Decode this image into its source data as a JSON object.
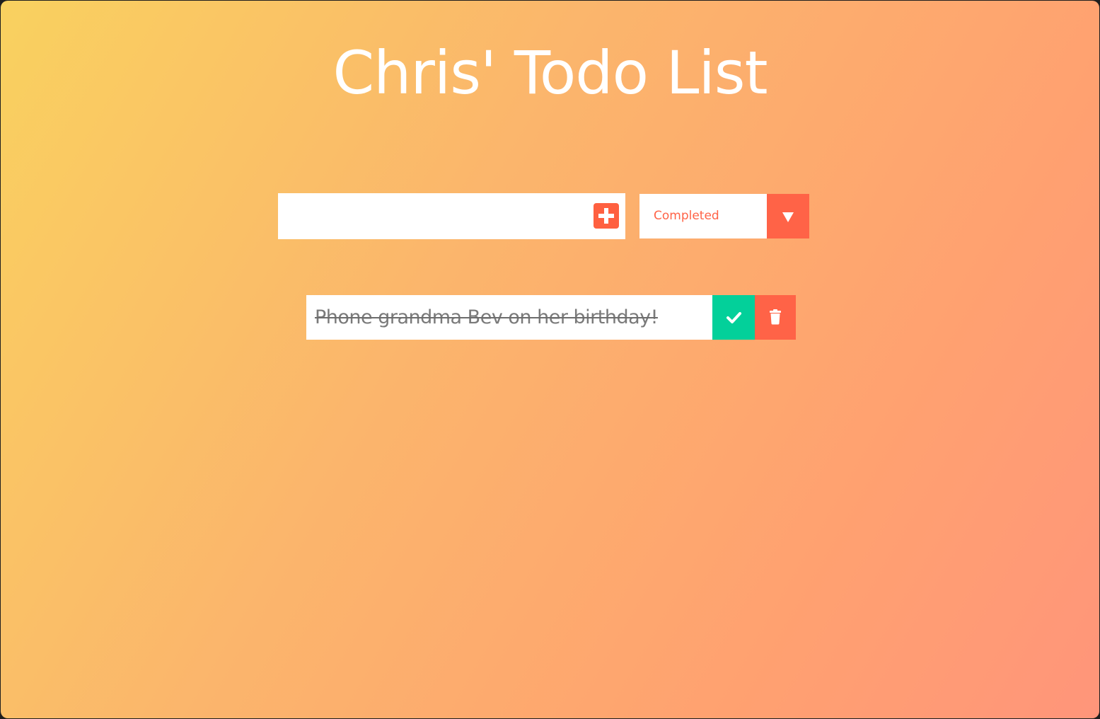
{
  "header": {
    "title": "Chris' Todo List"
  },
  "form": {
    "input_value": "",
    "input_placeholder": "",
    "add_icon": "plus-square-icon"
  },
  "filter": {
    "selected": "Completed",
    "arrow_icon": "caret-down-icon"
  },
  "todos": [
    {
      "text": "Phone grandma Bev on her birthday!",
      "completed": true,
      "complete_icon": "check-icon",
      "delete_icon": "trash-icon"
    }
  ],
  "colors": {
    "accent": "#ff6347",
    "complete": "#03d09a",
    "background_start": "#f9d15f",
    "background_end": "#ff957a"
  }
}
